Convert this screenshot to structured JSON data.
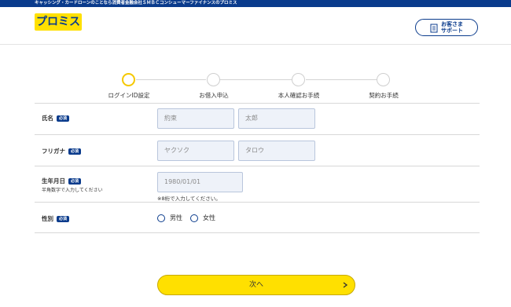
{
  "topbar": {
    "text": "キャッシング・カードローンのことなら消費者金融会社ＳＭＢＣコンシューマーファイナンスのプロミス"
  },
  "header": {
    "logo_text": "プロミス",
    "support_label_1": "お客さま",
    "support_label_2": "サポート",
    "support_icon": "document-icon"
  },
  "steps": [
    {
      "label": "ログインID設定",
      "active": true
    },
    {
      "label": "お借入申込",
      "active": false
    },
    {
      "label": "本人確認お手続",
      "active": false
    },
    {
      "label": "契約お手続",
      "active": false
    }
  ],
  "form": {
    "required_badge": "必須",
    "name": {
      "label": "氏名",
      "last_placeholder": "約束",
      "first_placeholder": "太郎"
    },
    "kana": {
      "label": "フリガナ",
      "last_placeholder": "ヤクソク",
      "first_placeholder": "タロウ"
    },
    "birth": {
      "label": "生年月日",
      "sub_label": "半角数字で入力してください",
      "placeholder": "1980/01/01",
      "note": "※8桁で入力してください。"
    },
    "gender": {
      "label": "性別",
      "options": [
        "男性",
        "女性"
      ]
    }
  },
  "next_button": {
    "label": "次へ",
    "arrow": "chevron-right-icon"
  },
  "colors": {
    "brand_blue": "#0a3b8c",
    "brand_yellow": "#ffe000",
    "step_active": "#f5c800"
  }
}
